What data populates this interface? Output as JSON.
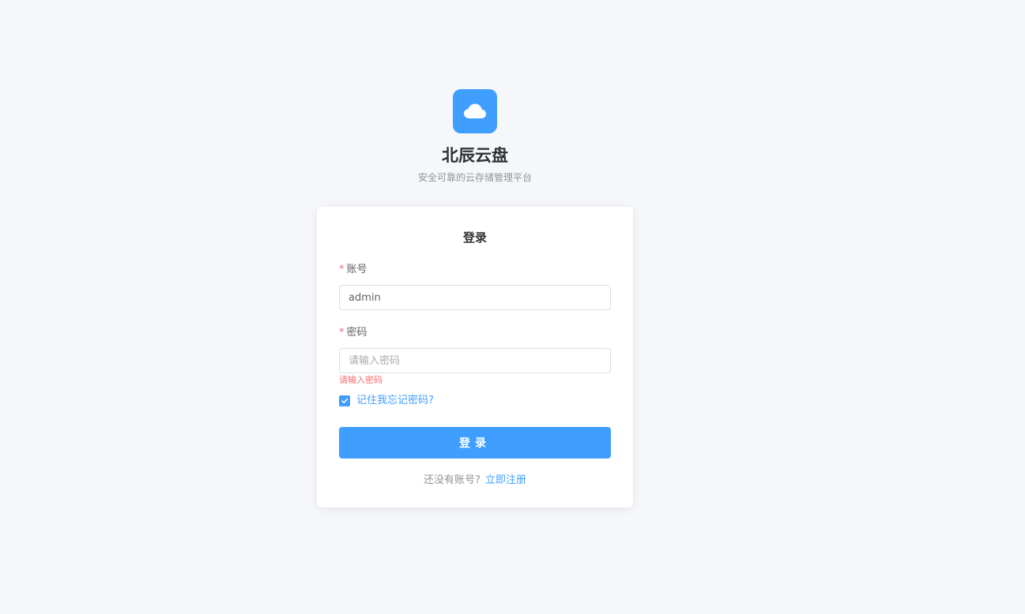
{
  "brand": {
    "logo_icon": "cloud-icon",
    "title": "北辰云盘",
    "subtitle": "安全可靠的云存储管理平台",
    "accent_color": "#409eff"
  },
  "login_card": {
    "title": "登录",
    "account": {
      "required_mark": "*",
      "label": "账号",
      "value": "admin",
      "placeholder": ""
    },
    "password": {
      "required_mark": "*",
      "label": "密码",
      "value": "",
      "placeholder": "请输入密码",
      "error": "请输入密码"
    },
    "remember": {
      "checked": true,
      "label": "记住我忘记密码?"
    },
    "submit_label": "登录",
    "register": {
      "prompt": "还没有账号?",
      "link": "立即注册"
    }
  },
  "colors": {
    "primary": "#409eff",
    "error": "#f56c6c",
    "background": "#f5f7fa"
  }
}
